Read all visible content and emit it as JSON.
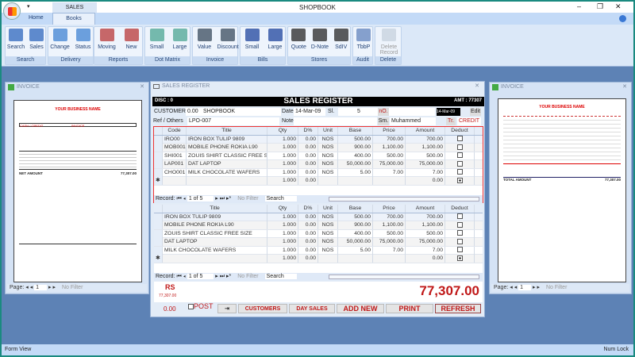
{
  "app": {
    "title": "SHOPBOOK",
    "context_tab": "SALES REGISTER",
    "qat": "▾"
  },
  "tabs": [
    {
      "label": "Home"
    },
    {
      "label": "Books"
    }
  ],
  "ribbon": [
    {
      "group": "Search",
      "buttons": [
        "Search",
        "Sales"
      ]
    },
    {
      "group": "Delivery",
      "buttons": [
        "Change",
        "Status"
      ]
    },
    {
      "group": "Reports",
      "buttons": [
        "Moving",
        "New"
      ]
    },
    {
      "group": "Dot Matrix",
      "buttons": [
        "Small",
        "Large"
      ]
    },
    {
      "group": "Invoice",
      "buttons": [
        "Value",
        "Discount"
      ]
    },
    {
      "group": "Bills",
      "buttons": [
        "Small",
        "Large"
      ]
    },
    {
      "group": "Stores",
      "buttons": [
        "Quote",
        "D-Note",
        "SdIV"
      ]
    },
    {
      "group": "Audit",
      "buttons": [
        "TbbP"
      ]
    },
    {
      "group": "Delete",
      "buttons": [
        "Delete Record"
      ]
    }
  ],
  "invoice_left": {
    "title": "INVOICE",
    "business": "YOUR BUSINESS NAME",
    "heading": "INVOICE",
    "cash_credit": "CASH / CREDIT",
    "net_amount_label": "NET AMOUNT",
    "net_amount": "77,307.00",
    "page_label": "Page:",
    "page": "1",
    "no_filter": "No Filter"
  },
  "invoice_right": {
    "title": "INVOICE",
    "business": "YOUR BUSINESS NAME",
    "total_label": "TOTAL AMOUNT",
    "total": "77,307.00",
    "page_label": "Page:",
    "page": "1",
    "no_filter": "No Filter"
  },
  "register": {
    "window_title": "SALES REGISTER",
    "banner": "SALES REGISTER",
    "disc": "DISC : 0",
    "amt": "AMT : 77307",
    "customer_label": "CUSTOMER",
    "customer_balance": "0.00",
    "customer": "SHOPBOOK",
    "date_label": "Date",
    "date": "14-Mar-09",
    "sl_label": "Sl.",
    "sl": "5",
    "no_label": "nO.",
    "no": "",
    "date2": "14-Mar-09",
    "edit": "Edit",
    "ref_label": "Ref / Others",
    "ref": "LPO-007",
    "note_label": "Note",
    "note": "",
    "sm_label": "Sm.",
    "salesman": "Muhammed",
    "tr_label": "Tr.",
    "tr": "CREDIT",
    "columns": [
      "Code",
      "Title",
      "Qty",
      "D%",
      "Unit",
      "Base",
      "Price",
      "Amount",
      "Deduct"
    ],
    "rows": [
      {
        "code": "IRO00",
        "title": "IRON BOX TULIP 9809",
        "qty": "1.000",
        "disc": "0.00",
        "unit": "NOS",
        "base": "500.00",
        "price": "700.00",
        "amount": "700.00",
        "deduct": false
      },
      {
        "code": "MOB001",
        "title": "MOBILE PHONE ROKIA L90",
        "qty": "1.000",
        "disc": "0.00",
        "unit": "NOS",
        "base": "900.00",
        "price": "1,100.00",
        "amount": "1,100.00",
        "deduct": false
      },
      {
        "code": "SHI001",
        "title": "ZOUIS SHIRT CLASSIC FREE SIZE",
        "qty": "1.000",
        "disc": "0.00",
        "unit": "NOS",
        "base": "400.00",
        "price": "500.00",
        "amount": "500.00",
        "deduct": false
      },
      {
        "code": "LAP001",
        "title": "DAT LAPTOP",
        "qty": "1.000",
        "disc": "0.00",
        "unit": "NOS",
        "base": "50,000.00",
        "price": "75,000.00",
        "amount": "75,000.00",
        "deduct": false
      },
      {
        "code": "CHO001",
        "title": "MILK CHOCOLATE WAFERS",
        "qty": "1.000",
        "disc": "0.00",
        "unit": "NOS",
        "base": "5.00",
        "price": "7.00",
        "amount": "7.00",
        "deduct": false
      }
    ],
    "new_row": {
      "qty": "1.000",
      "disc": "0.00",
      "amount": "0.00"
    },
    "record_label": "Record:",
    "record": "1 of 5",
    "no_filter": "No Filter",
    "search": "Search",
    "currency": "RS",
    "sub_total": "77,307.00",
    "zero": "0.00",
    "grand_total": "77,307.00",
    "post": "POST",
    "buttons": {
      "customers": "CUSTOMERS",
      "day_sales": "DAY SALES",
      "add_new": "ADD NEW",
      "print": "PRINT",
      "refresh": "REFRESH"
    }
  },
  "status": {
    "left": "Form View",
    "right": "Num Lock"
  },
  "colors": {
    "accent_red": "#c01818",
    "banner": "#000000",
    "ribbon": "#dbe8f8"
  }
}
